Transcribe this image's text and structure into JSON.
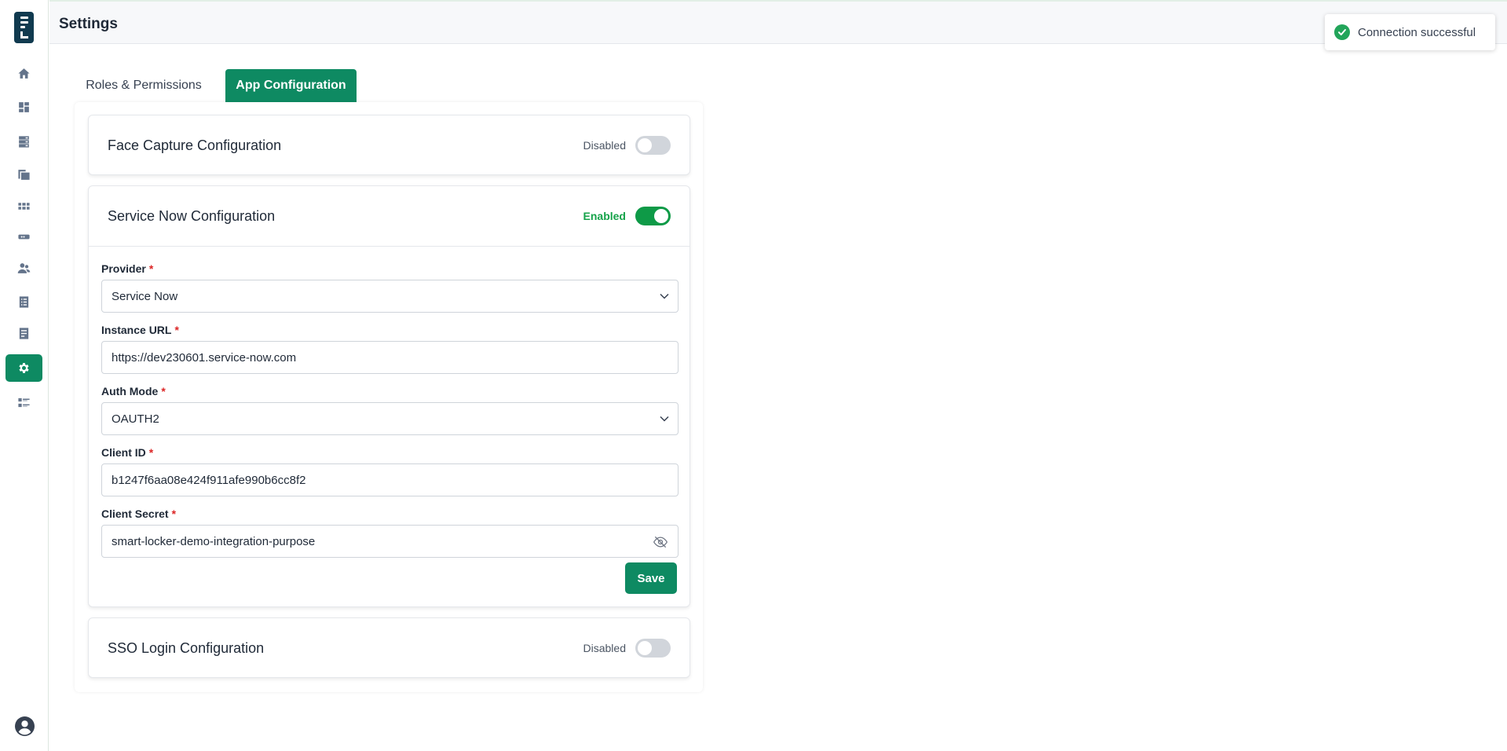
{
  "header": {
    "title": "Settings"
  },
  "toast": {
    "message": "Connection successful"
  },
  "sidebar": {
    "items": [
      {
        "icon": "home-icon"
      },
      {
        "icon": "dashboard-icon"
      },
      {
        "icon": "locker-icon"
      },
      {
        "icon": "devices-icon"
      },
      {
        "icon": "grid-icon"
      },
      {
        "icon": "card-icon"
      },
      {
        "icon": "users-icon"
      },
      {
        "icon": "list-icon"
      },
      {
        "icon": "report-icon"
      },
      {
        "icon": "gear-icon",
        "active": true
      },
      {
        "icon": "checklist-icon"
      }
    ]
  },
  "tabs": [
    {
      "label": "Roles & Permissions"
    },
    {
      "label": "App Configuration",
      "active": true
    }
  ],
  "face_capture": {
    "title": "Face Capture Configuration",
    "status": "Disabled"
  },
  "service_now": {
    "title": "Service Now Configuration",
    "status": "Enabled",
    "fields": {
      "provider": {
        "label": "Provider",
        "value": "Service Now"
      },
      "instance_url": {
        "label": "Instance URL",
        "value": "https://dev230601.service-now.com"
      },
      "auth_mode": {
        "label": "Auth Mode",
        "value": "OAUTH2"
      },
      "client_id": {
        "label": "Client ID",
        "value": "b1247f6aa08e424f911afe990b6cc8f2"
      },
      "client_secret": {
        "label": "Client Secret",
        "value": "smart-locker-demo-integration-purpose"
      }
    },
    "save_label": "Save"
  },
  "sso": {
    "title": "SSO Login Configuration",
    "status": "Disabled"
  },
  "colors": {
    "accent": "#0e8a62",
    "toggle_on": "#0e9a47",
    "success": "#22a55a",
    "required": "#dc2626"
  }
}
